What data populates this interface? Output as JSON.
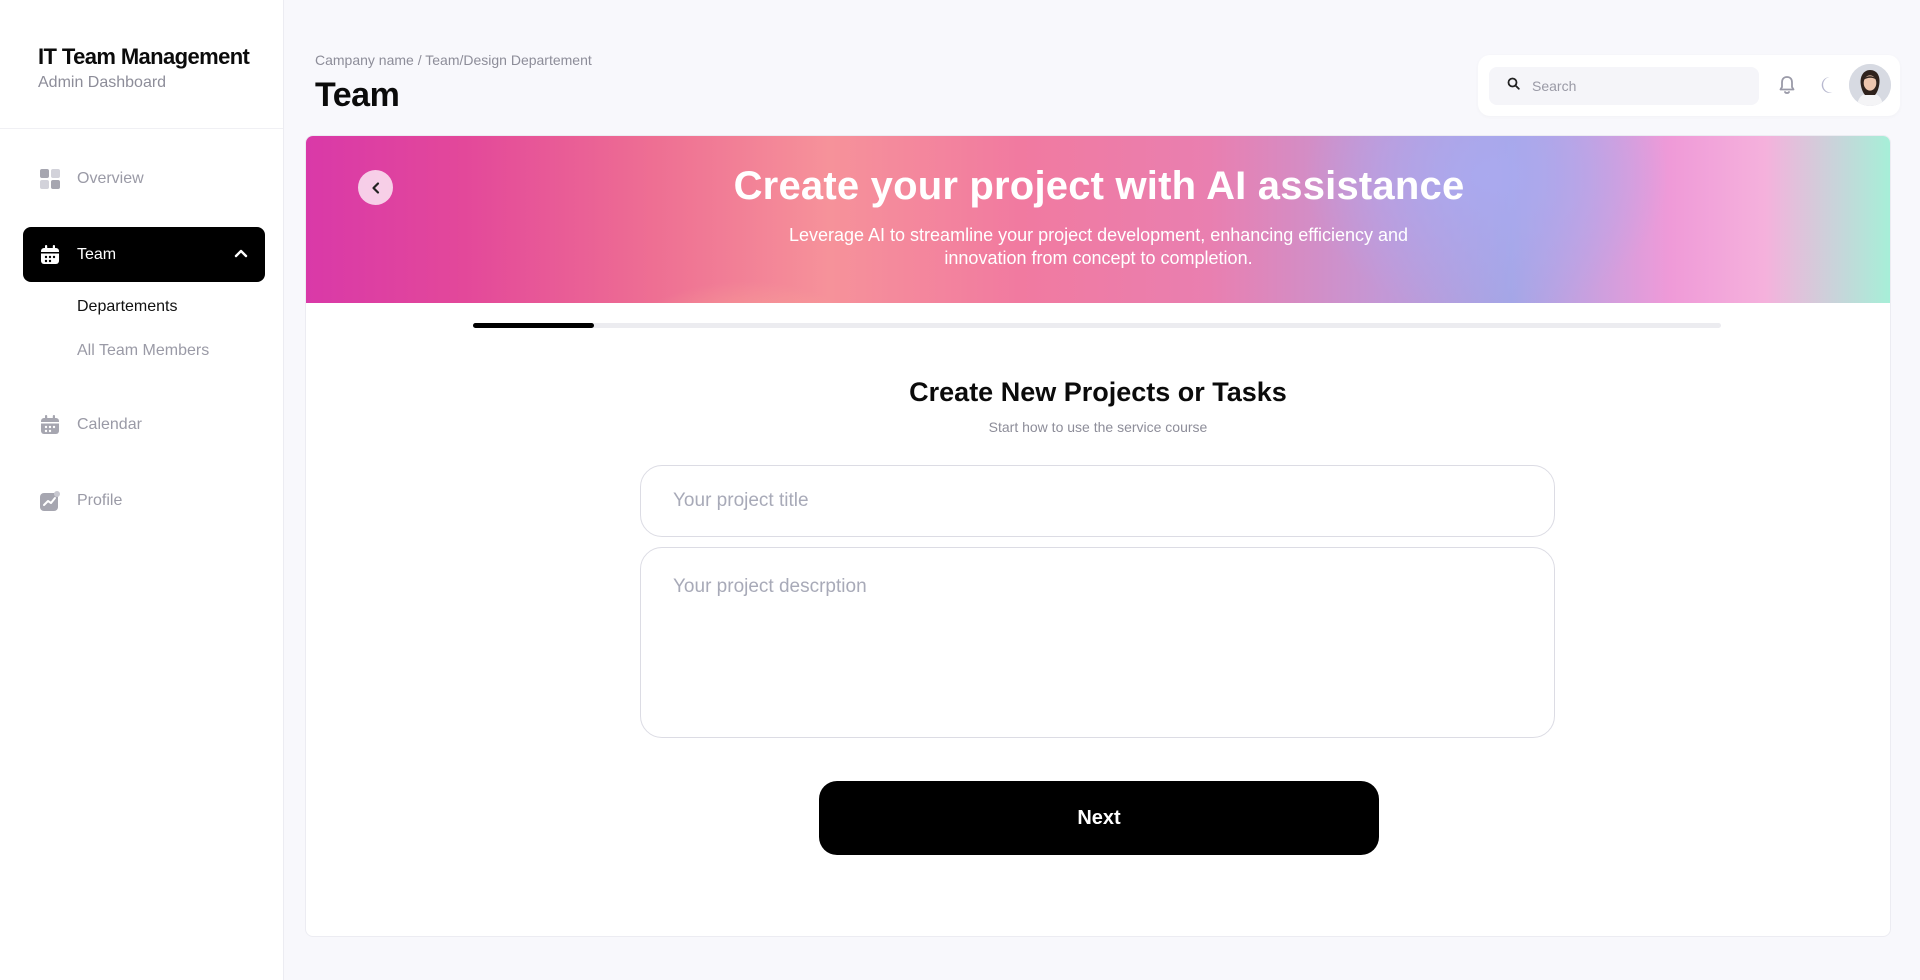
{
  "app": {
    "title": "IT Team Management",
    "subtitle": "Admin Dashboard"
  },
  "sidebar": {
    "items": [
      {
        "label": "Overview",
        "icon": "grid-icon",
        "active": false
      },
      {
        "label": "Team",
        "icon": "calendar-icon",
        "active": true,
        "expanded": true,
        "children": [
          {
            "label": "Departements",
            "current": true
          },
          {
            "label": "All Team Members",
            "current": false
          }
        ]
      },
      {
        "label": "Calendar",
        "icon": "calendar-icon",
        "active": false
      },
      {
        "label": "Profile",
        "icon": "chart-icon",
        "active": false
      }
    ]
  },
  "header": {
    "breadcrumb": "Campany name / Team/Design Departement",
    "title": "Team",
    "search_placeholder": "Search"
  },
  "banner": {
    "title": "Create your project with AI assistance",
    "subtitle": "Leverage AI to streamline your project development, enhancing efficiency and innovation from concept to completion."
  },
  "progress": {
    "value": 0.097
  },
  "form": {
    "title": "Create New Projects or Tasks",
    "subtitle": "Start how to use the service course",
    "title_placeholder": "Your project title",
    "description_placeholder": "Your project descrption",
    "next_label": "Next"
  },
  "colors": {
    "accent": "#000000",
    "background": "#f8f8fc",
    "muted_text": "#9a9aa6"
  }
}
